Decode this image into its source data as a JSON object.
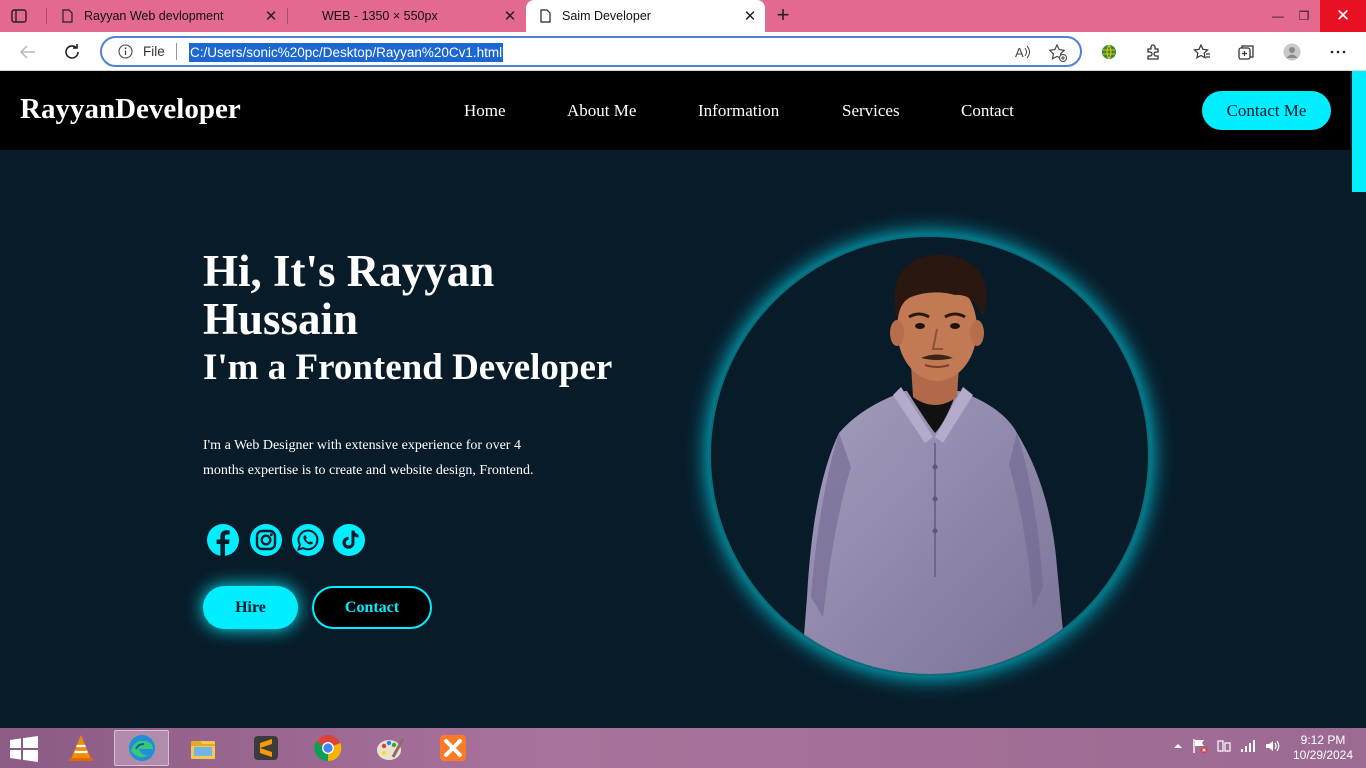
{
  "browser": {
    "tabs": [
      {
        "title": "Rayyan Web devlopment",
        "active": false
      },
      {
        "title": "WEB - 1350 × 550px",
        "active": false
      },
      {
        "title": "Saim Developer",
        "active": true
      }
    ],
    "address": {
      "scheme_label": "File",
      "url": "C:/Users/sonic%20pc/Desktop/Rayyan%20Cv1.html"
    }
  },
  "site": {
    "logo": "RayyanDeveloper",
    "nav": [
      "Home",
      "About Me",
      "Information",
      "Services",
      "Contact"
    ],
    "cta": "Contact Me"
  },
  "hero": {
    "heading": "Hi, It's Rayyan Hussain",
    "subheading": "I'm a Frontend Developer",
    "description": "I'm a Web Designer with extensive experience for over 4 months expertise is to create and website design, Frontend.",
    "socials": [
      "facebook-icon",
      "instagram-icon",
      "whatsapp-icon",
      "tiktok-icon"
    ],
    "buttons": {
      "hire": "Hire",
      "contact": "Contact"
    }
  },
  "taskbar": {
    "apps": [
      "vlc-icon",
      "edge-icon",
      "file-explorer-icon",
      "sublime-text-icon",
      "chrome-icon",
      "paint-icon",
      "xampp-icon"
    ],
    "clock": {
      "time": "9:12 PM",
      "date": "10/29/2024"
    }
  },
  "colors": {
    "accent": "#00eeff",
    "page_bg": "#081b29",
    "nav_bg": "#000000",
    "tabbar": "#e3698e"
  }
}
